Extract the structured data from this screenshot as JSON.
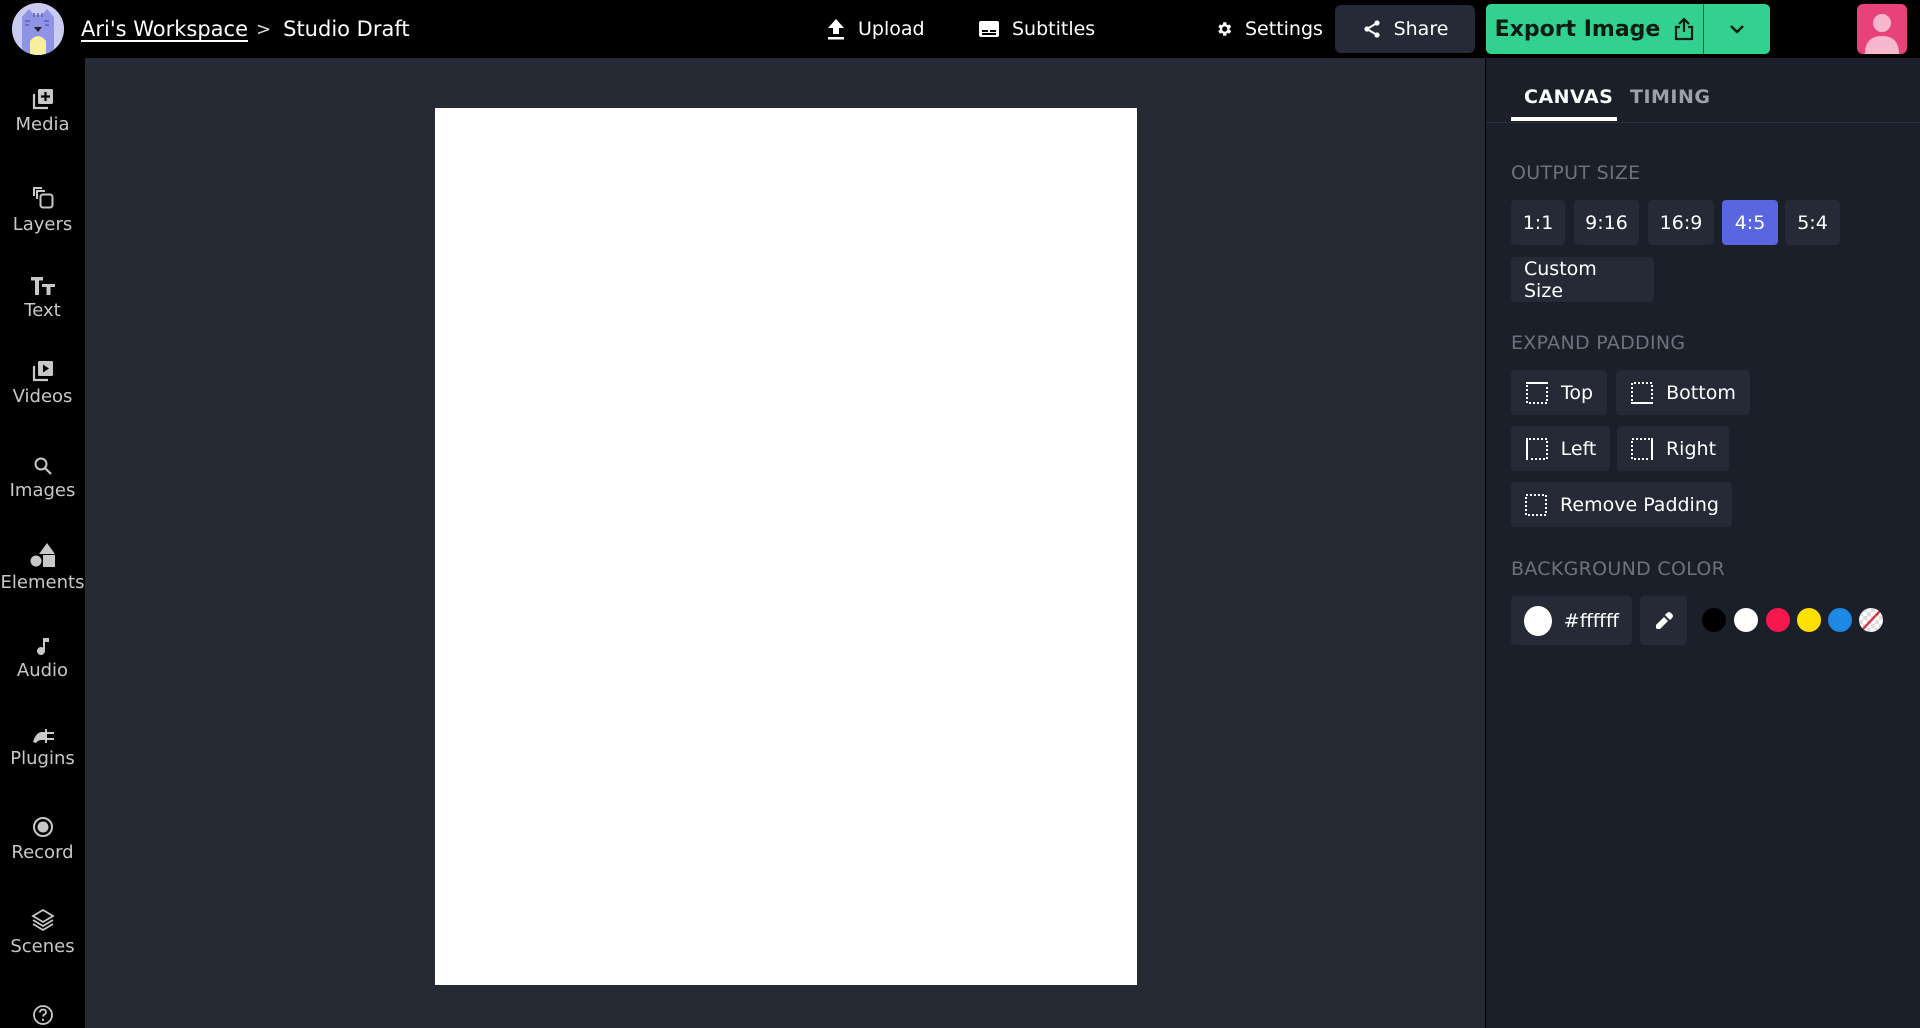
{
  "header": {
    "workspace_link": "Ari's Workspace",
    "separator": ">",
    "project_title": "Studio Draft",
    "upload_label": "Upload",
    "subtitles_label": "Subtitles",
    "settings_label": "Settings",
    "share_label": "Share",
    "export_label": "Export Image"
  },
  "sidebar": {
    "items": [
      {
        "label": "Media",
        "icon": "media-add-icon"
      },
      {
        "label": "Layers",
        "icon": "layers-icon"
      },
      {
        "label": "Text",
        "icon": "text-icon"
      },
      {
        "label": "Videos",
        "icon": "video-play-icon"
      },
      {
        "label": "Images",
        "icon": "search-icon"
      },
      {
        "label": "Elements",
        "icon": "shapes-icon"
      },
      {
        "label": "Audio",
        "icon": "music-note-icon"
      },
      {
        "label": "Plugins",
        "icon": "plug-icon"
      },
      {
        "label": "Record",
        "icon": "record-icon"
      },
      {
        "label": "Scenes",
        "icon": "stack-icon"
      }
    ],
    "help_icon": "help-icon"
  },
  "canvas": {
    "background_color": "#ffffff",
    "aspect_ratio": "4:5"
  },
  "panel": {
    "tabs": [
      {
        "label": "CANVAS",
        "active": true
      },
      {
        "label": "TIMING",
        "active": false
      }
    ],
    "output_size": {
      "label": "OUTPUT SIZE",
      "options": [
        "1:1",
        "9:16",
        "16:9",
        "4:5",
        "5:4"
      ],
      "selected": "4:5",
      "custom_label": "Custom Size"
    },
    "expand_padding": {
      "label": "EXPAND PADDING",
      "top": "Top",
      "bottom": "Bottom",
      "left": "Left",
      "right": "Right",
      "remove": "Remove Padding"
    },
    "background_color": {
      "label": "BACKGROUND COLOR",
      "value": "#ffffff",
      "swatches": [
        "#000000",
        "#ffffff",
        "#f5174d",
        "#ffe100",
        "#1e88e5",
        "transparent"
      ]
    }
  },
  "colors": {
    "accent_export": "#33d18f",
    "accent_selected": "#5a65e0",
    "avatar_bg": "#e8427b"
  }
}
